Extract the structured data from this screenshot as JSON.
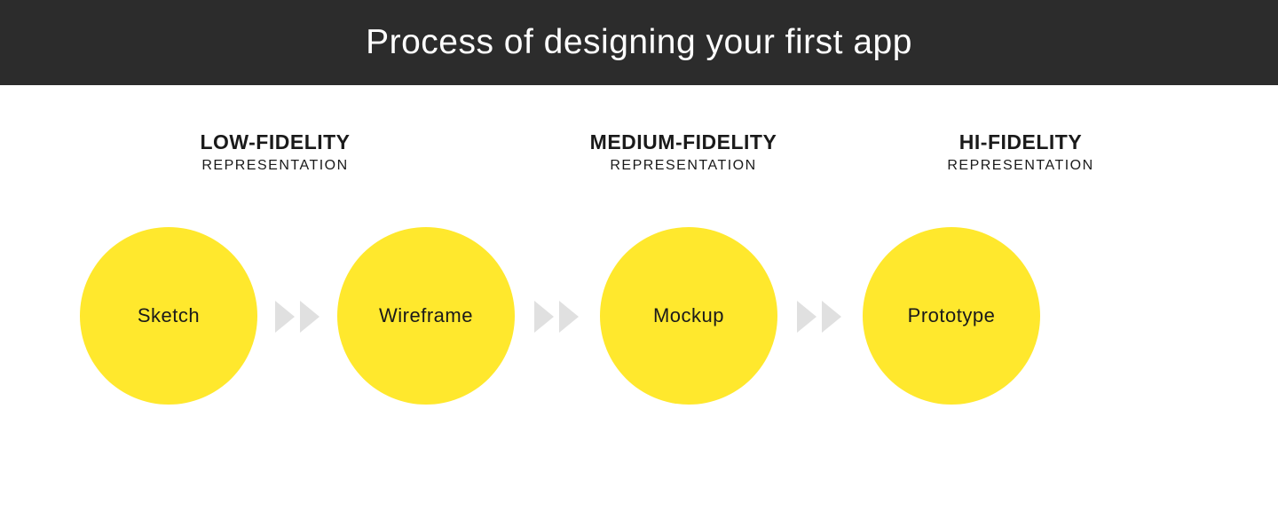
{
  "header": {
    "title": "Process of designing your first app"
  },
  "fidelity": {
    "low": {
      "title": "LOW-FIDELITY",
      "sub": "REPRESENTATION"
    },
    "medium": {
      "title": "MEDIUM-FIDELITY",
      "sub": "REPRESENTATION"
    },
    "high": {
      "title": "HI-FIDELITY",
      "sub": "REPRESENTATION"
    }
  },
  "steps": {
    "sketch": "Sketch",
    "wireframe": "Wireframe",
    "mockup": "Mockup",
    "prototype": "Prototype"
  },
  "colors": {
    "headerBg": "#2c2c2c",
    "accent": "#ffe82d",
    "chevron": "#e0e0e0"
  }
}
